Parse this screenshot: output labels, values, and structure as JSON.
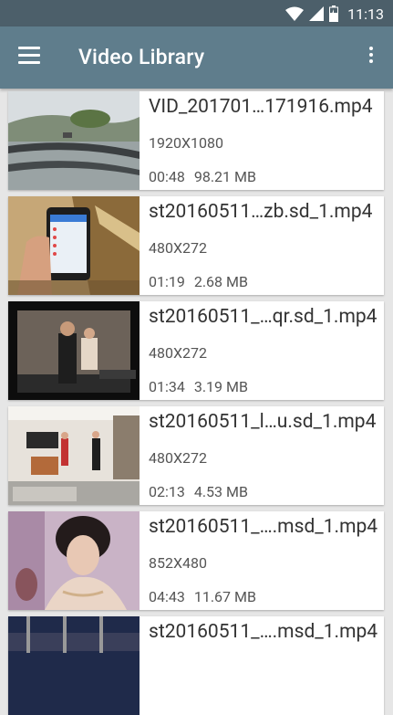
{
  "status_bar": {
    "time": "11:13"
  },
  "app_bar": {
    "title": "Video Library"
  },
  "videos": [
    {
      "name": "VID_201701…171916.mp4",
      "resolution": "1920X1080",
      "duration": "00:48",
      "size": "98.21 MB"
    },
    {
      "name": "st20160511…zb.sd_1.mp4",
      "resolution": "480X272",
      "duration": "01:19",
      "size": "2.68 MB"
    },
    {
      "name": "st20160511_…qr.sd_1.mp4",
      "resolution": "480X272",
      "duration": "01:34",
      "size": "3.19 MB"
    },
    {
      "name": "st20160511_l…u.sd_1.mp4",
      "resolution": "480X272",
      "duration": "02:13",
      "size": "4.53 MB"
    },
    {
      "name": "st20160511_….msd_1.mp4",
      "resolution": "852X480",
      "duration": "04:43",
      "size": "11.67 MB"
    },
    {
      "name": "st20160511_….msd_1.mp4"
    }
  ]
}
